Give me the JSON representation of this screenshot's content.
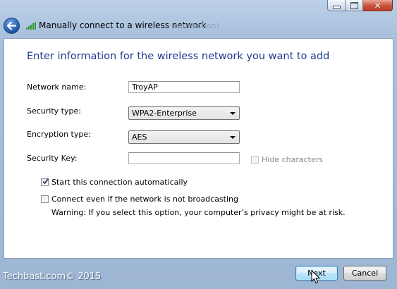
{
  "window": {
    "title": "Manually connect to a wireless network",
    "ghost_title_text": "connection)",
    "caption_buttons": {
      "minimize": "minimize",
      "maximize": "maximize",
      "close": "close"
    }
  },
  "main": {
    "heading": "Enter information for the wireless network you want to add",
    "network_name": {
      "label": "Network name:",
      "value": "TroyAP"
    },
    "security_type": {
      "label": "Security type:",
      "selected": "WPA2-Enterprise"
    },
    "encryption_type": {
      "label": "Encryption type:",
      "selected": "AES"
    },
    "security_key": {
      "label": "Security Key:",
      "value": "",
      "hide_characters_label": "Hide characters",
      "hide_characters_checked": false,
      "hide_characters_enabled": false
    },
    "start_automatically": {
      "label": "Start this connection automatically",
      "checked": true
    },
    "connect_not_broadcasting": {
      "label": "Connect even if the network is not broadcasting",
      "checked": false
    },
    "warning": "Warning: If you select this option, your computer’s privacy might be at risk."
  },
  "footer": {
    "watermark": "Techbast.com© 2015",
    "next_label": "Next",
    "cancel_label": "Cancel"
  },
  "colors": {
    "heading": "#1e3c8c",
    "close_button": "#c7503a",
    "default_button_border": "#3c7fb1"
  },
  "icons": [
    "back-arrow-icon",
    "wireless-signal-icon",
    "checkmark-icon",
    "mouse-cursor-icon"
  ]
}
